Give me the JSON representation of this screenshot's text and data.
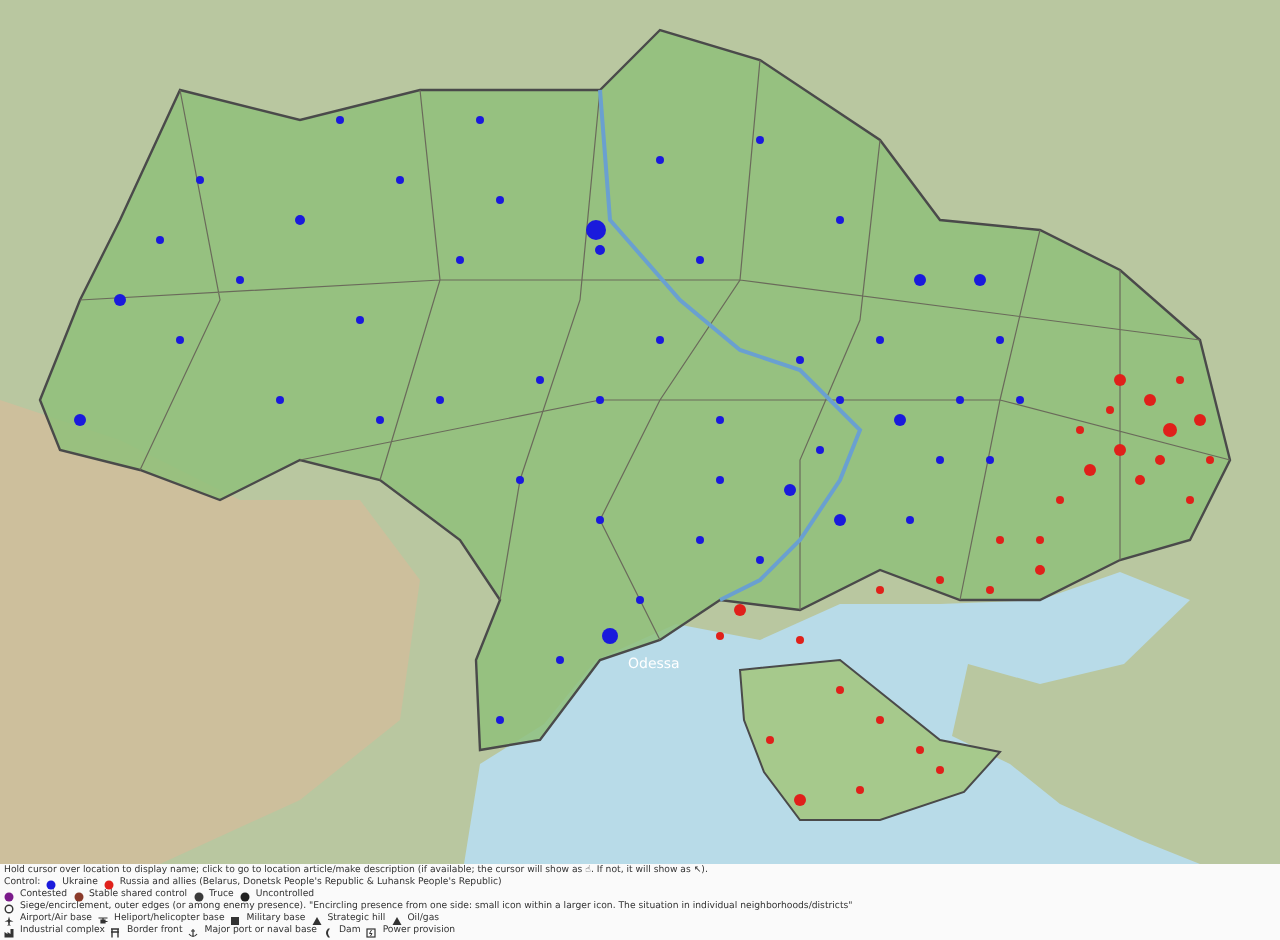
{
  "map": {
    "city_labels": [
      {
        "label": "Odessa"
      }
    ]
  },
  "legend": {
    "intro": "Hold cursor over location to display name; click to go to location article/make description (if available; the cursor will show as ☝. If not, it will show as ↖).",
    "lines": [
      {
        "items": [
          {
            "kind": "text",
            "label": "Control:"
          },
          {
            "kind": "dot",
            "color": "#1a1adc",
            "label": "Ukraine"
          },
          {
            "kind": "dot",
            "color": "#e0201a",
            "label": "Russia and allies (Belarus, Donetsk People's Republic & Luhansk People's Republic)"
          }
        ]
      },
      {
        "items": [
          {
            "kind": "dot",
            "color": "#7a1a8a",
            "label": "Contested"
          },
          {
            "kind": "dot",
            "color": "#8a3a2a",
            "label": "Stable shared control"
          },
          {
            "kind": "dot",
            "color": "#3a3a3a",
            "label": "Truce"
          },
          {
            "kind": "dot",
            "color": "#222222",
            "label": "Uncontrolled"
          }
        ]
      },
      {
        "items": [
          {
            "kind": "ring",
            "label": "Siege/encirclement, outer edges (or among enemy presence). \"Encircling presence from one side: small icon within a larger icon. The situation in individual neighborhoods/districts\""
          }
        ]
      },
      {
        "items": [
          {
            "kind": "plane",
            "label": "Airport/Air base"
          },
          {
            "kind": "heli",
            "label": "Heliport/helicopter base"
          },
          {
            "kind": "base",
            "label": "Military base"
          },
          {
            "kind": "hill",
            "label": "Strategic hill"
          },
          {
            "kind": "hill",
            "label": "Oil/gas"
          }
        ]
      },
      {
        "items": [
          {
            "kind": "factory",
            "label": "Industrial complex"
          },
          {
            "kind": "front",
            "label": "Border front"
          },
          {
            "kind": "anchor",
            "label": "Major port or naval base"
          },
          {
            "kind": "dam",
            "label": "Dam"
          },
          {
            "kind": "power",
            "label": "Power provision"
          }
        ]
      }
    ]
  }
}
